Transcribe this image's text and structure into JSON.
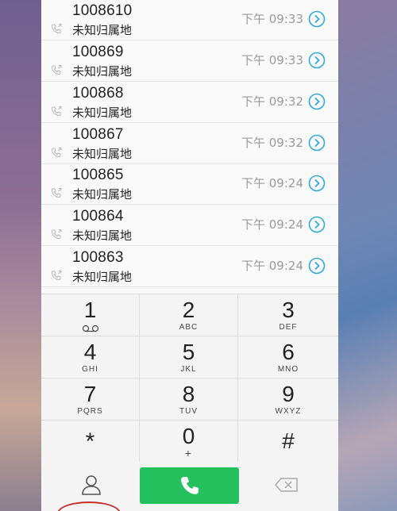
{
  "calls": [
    {
      "number": "1008610",
      "location": "未知归属地",
      "time": "下午 09:33"
    },
    {
      "number": "100869",
      "location": "未知归属地",
      "time": "下午 09:33"
    },
    {
      "number": "100868",
      "location": "未知归属地",
      "time": "下午 09:32"
    },
    {
      "number": "100867",
      "location": "未知归属地",
      "time": "下午 09:32"
    },
    {
      "number": "100865",
      "location": "未知归属地",
      "time": "下午 09:24"
    },
    {
      "number": "100864",
      "location": "未知归属地",
      "time": "下午 09:24"
    },
    {
      "number": "100863",
      "location": "未知归属地",
      "time": "下午 09:24"
    }
  ],
  "keys": [
    {
      "digit": "1",
      "letters": ""
    },
    {
      "digit": "2",
      "letters": "ABC"
    },
    {
      "digit": "3",
      "letters": "DEF"
    },
    {
      "digit": "4",
      "letters": "GHI"
    },
    {
      "digit": "5",
      "letters": "JKL"
    },
    {
      "digit": "6",
      "letters": "MNO"
    },
    {
      "digit": "7",
      "letters": "PQRS"
    },
    {
      "digit": "8",
      "letters": "TUV"
    },
    {
      "digit": "9",
      "letters": "WXYZ"
    },
    {
      "digit": "*",
      "letters": ""
    },
    {
      "digit": "0",
      "letters": "+"
    },
    {
      "digit": "#",
      "letters": ""
    }
  ],
  "colors": {
    "accent": "#2eaadc",
    "call_green": "#25c05e",
    "icons": [
      "phone-icon",
      "info-icon",
      "voicemail-icon",
      "contact-icon",
      "backspace-icon"
    ]
  }
}
